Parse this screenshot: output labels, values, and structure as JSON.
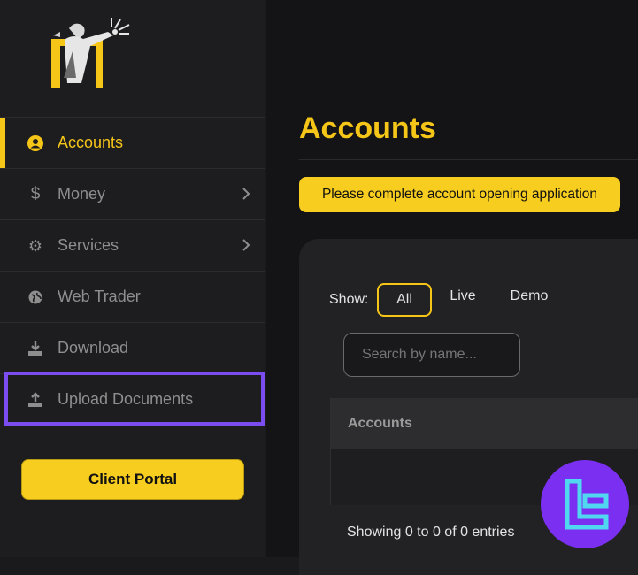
{
  "sidebar": {
    "items": [
      {
        "label": "Accounts",
        "icon": "user-circle-icon",
        "active": true
      },
      {
        "label": "Money",
        "icon": "dollar-icon",
        "has_submenu": true
      },
      {
        "label": "Services",
        "icon": "gear-icon",
        "has_submenu": true
      },
      {
        "label": "Web Trader",
        "icon": "globe-icon"
      },
      {
        "label": "Download",
        "icon": "download-icon"
      },
      {
        "label": "Upload Documents",
        "icon": "upload-icon"
      }
    ],
    "client_portal_label": "Client Portal"
  },
  "main": {
    "title": "Accounts",
    "banner": "Please complete account opening application",
    "filter": {
      "show_label": "Show:",
      "options": [
        "All",
        "Live",
        "Demo"
      ],
      "selected": "All"
    },
    "search": {
      "placeholder": "Search by name..."
    },
    "table": {
      "columns": [
        "Accounts"
      ],
      "rows": []
    },
    "entries_text": "Showing 0 to 0 of 0 entries"
  },
  "colors": {
    "accent": "#f5c518",
    "highlight": "#7b4cf0",
    "badge": "#7b2ff0"
  }
}
